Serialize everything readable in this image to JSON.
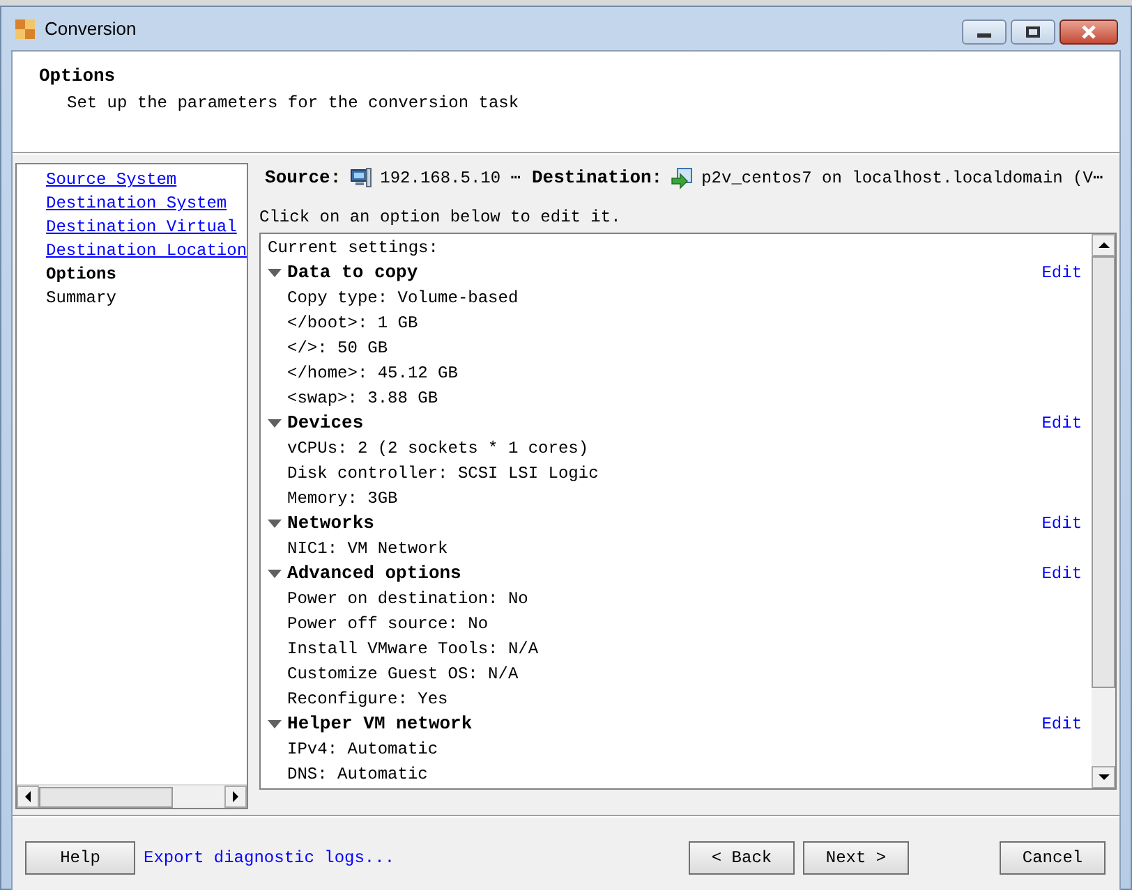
{
  "window": {
    "title": "Conversion"
  },
  "header": {
    "title": "Options",
    "subtitle": "Set up the parameters for the conversion task"
  },
  "nav": [
    {
      "label": "Source System",
      "link": true,
      "selected": false
    },
    {
      "label": "Destination System",
      "link": true,
      "selected": false
    },
    {
      "label": "Destination Virtual",
      "link": true,
      "selected": false
    },
    {
      "label": "Destination Location",
      "link": true,
      "selected": false
    },
    {
      "label": "Options",
      "link": false,
      "selected": true
    },
    {
      "label": "Summary",
      "link": false,
      "selected": false
    }
  ],
  "summary": {
    "source_label": "Source:",
    "source": "192.168.5.10 ⋯",
    "destination_label": "Destination:",
    "destination": "p2v_centos7 on localhost.localdomain (V⋯"
  },
  "instruction": "Click on an option below to edit it.",
  "settings": {
    "heading": "Current settings:",
    "sections": [
      {
        "title": "Data to copy",
        "expanded": true,
        "edit": "Edit",
        "items": [
          "Copy type: Volume-based",
          "</boot>: 1 GB",
          "</>: 50 GB",
          "</home>: 45.12 GB",
          "<swap>: 3.88 GB"
        ]
      },
      {
        "title": "Devices",
        "expanded": true,
        "edit": "Edit",
        "items": [
          "vCPUs: 2 (2 sockets * 1 cores)",
          "Disk controller: SCSI LSI Logic",
          "Memory: 3GB"
        ]
      },
      {
        "title": "Networks",
        "expanded": true,
        "edit": "Edit",
        "items": [
          "NIC1: VM Network"
        ]
      },
      {
        "title": "Advanced options",
        "expanded": true,
        "edit": "Edit",
        "items": [
          "Power on destination: No",
          "Power off source: No",
          "Install VMware Tools: N/A",
          "Customize Guest OS: N/A",
          "Reconfigure: Yes"
        ]
      },
      {
        "title": "Helper VM network",
        "expanded": true,
        "edit": "Edit",
        "items": [
          "IPv4: Automatic",
          "DNS: Automatic"
        ]
      }
    ]
  },
  "footer": {
    "help": "Help",
    "export": "Export diagnostic logs...",
    "back": "< Back",
    "next": "Next >",
    "cancel": "Cancel"
  }
}
